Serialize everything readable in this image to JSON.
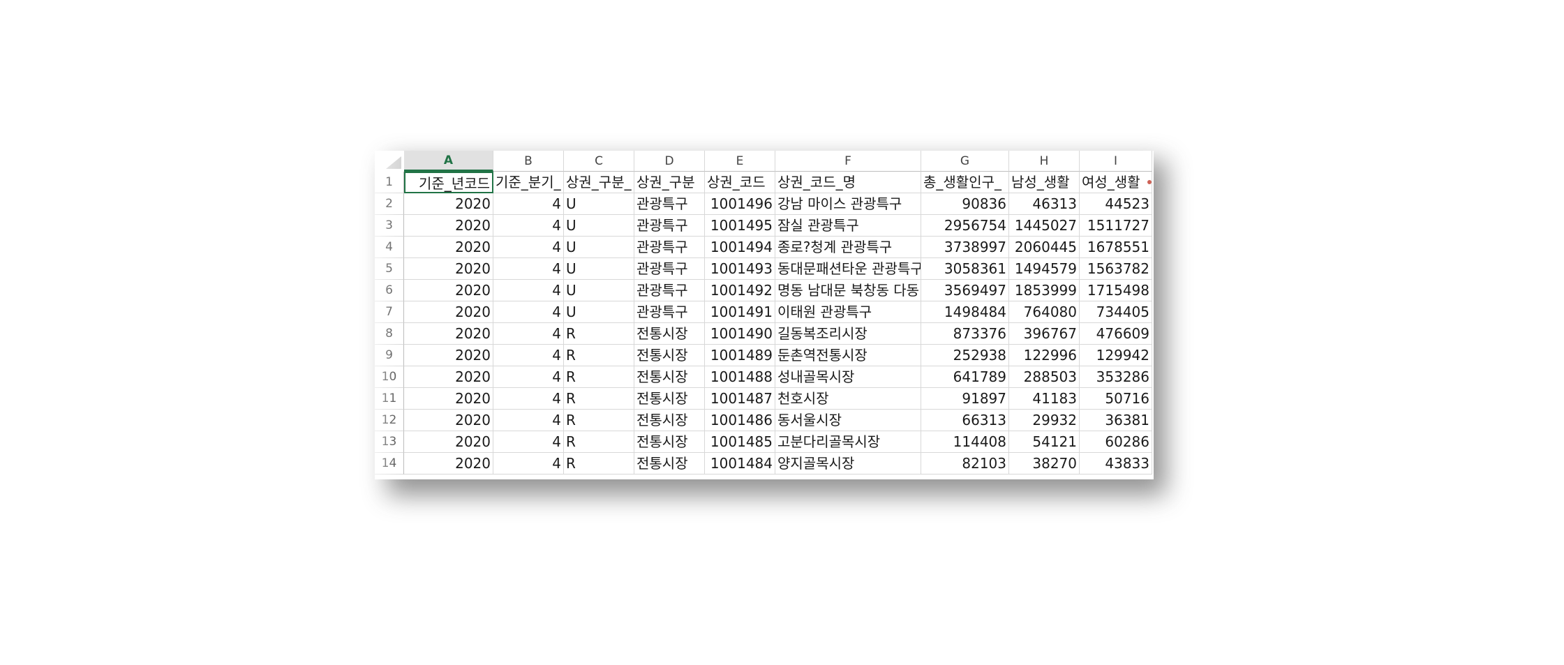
{
  "columns": [
    "A",
    "B",
    "C",
    "D",
    "E",
    "F",
    "G",
    "H",
    "I"
  ],
  "selected_column": "A",
  "header_row": [
    "기준_년코드",
    "기준_분기_",
    "상권_구분_",
    "상권_구분",
    "상권_코드",
    "상권_코드_명",
    "총_생활인구_",
    "남성_생활",
    "여성_생활"
  ],
  "rows": [
    {
      "n": "2",
      "cells": [
        "2020",
        "4",
        "U",
        "관광특구",
        "1001496",
        "강남 마이스 관광특구",
        "90836",
        "46313",
        "44523"
      ]
    },
    {
      "n": "3",
      "cells": [
        "2020",
        "4",
        "U",
        "관광특구",
        "1001495",
        "잠실 관광특구",
        "2956754",
        "1445027",
        "1511727"
      ]
    },
    {
      "n": "4",
      "cells": [
        "2020",
        "4",
        "U",
        "관광특구",
        "1001494",
        "종로?청계 관광특구",
        "3738997",
        "2060445",
        "1678551"
      ]
    },
    {
      "n": "5",
      "cells": [
        "2020",
        "4",
        "U",
        "관광특구",
        "1001493",
        "동대문패션타운 관광특구",
        "3058361",
        "1494579",
        "1563782"
      ]
    },
    {
      "n": "6",
      "cells": [
        "2020",
        "4",
        "U",
        "관광특구",
        "1001492",
        "명동 남대문 북창동 다동",
        "3569497",
        "1853999",
        "1715498"
      ]
    },
    {
      "n": "7",
      "cells": [
        "2020",
        "4",
        "U",
        "관광특구",
        "1001491",
        "이태원 관광특구",
        "1498484",
        "764080",
        "734405"
      ]
    },
    {
      "n": "8",
      "cells": [
        "2020",
        "4",
        "R",
        "전통시장",
        "1001490",
        "길동복조리시장",
        "873376",
        "396767",
        "476609"
      ]
    },
    {
      "n": "9",
      "cells": [
        "2020",
        "4",
        "R",
        "전통시장",
        "1001489",
        "둔촌역전통시장",
        "252938",
        "122996",
        "129942"
      ]
    },
    {
      "n": "10",
      "cells": [
        "2020",
        "4",
        "R",
        "전통시장",
        "1001488",
        "성내골목시장",
        "641789",
        "288503",
        "353286"
      ]
    },
    {
      "n": "11",
      "cells": [
        "2020",
        "4",
        "R",
        "전통시장",
        "1001487",
        "천호시장",
        "91897",
        "41183",
        "50716"
      ]
    },
    {
      "n": "12",
      "cells": [
        "2020",
        "4",
        "R",
        "전통시장",
        "1001486",
        "동서울시장",
        "66313",
        "29932",
        "36381"
      ]
    },
    {
      "n": "13",
      "cells": [
        "2020",
        "4",
        "R",
        "전통시장",
        "1001485",
        "고분다리골목시장",
        "114408",
        "54121",
        "60286"
      ]
    },
    {
      "n": "14",
      "cells": [
        "2020",
        "4",
        "R",
        "전통시장",
        "1001484",
        "양지골목시장",
        "82103",
        "38270",
        "43833"
      ]
    }
  ],
  "column_align": [
    "num",
    "num",
    "txt",
    "txt",
    "num",
    "txt",
    "num",
    "num",
    "num"
  ],
  "colors": {
    "selected_header_text": "#217346",
    "selected_header_bg": "#e1e1e1",
    "gridline": "#d8d8d8"
  }
}
